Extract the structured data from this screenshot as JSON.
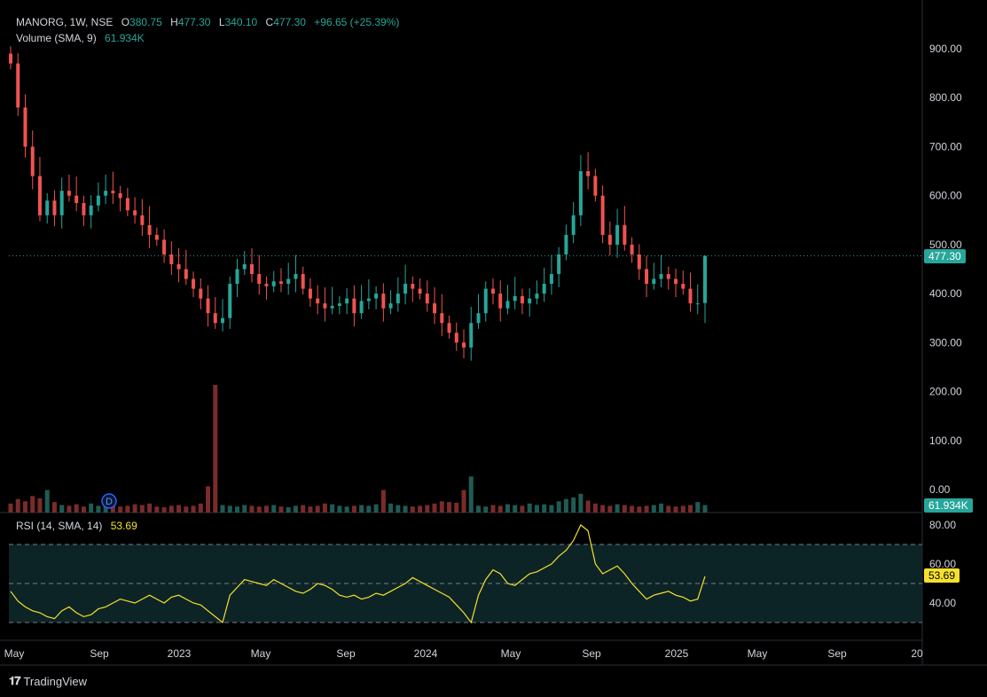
{
  "header": {
    "symbol": "MANORG, 1W, NSE",
    "o_label": "O",
    "o_value": "380.75",
    "h_label": "H",
    "h_value": "477.30",
    "l_label": "L",
    "l_value": "340.10",
    "c_label": "C",
    "c_value": "477.30",
    "change": "+96.65 (+25.39%)",
    "volume_label": "Volume (SMA, 9)",
    "volume_value": "61.934K",
    "rsi_label": "RSI (14, SMA, 14)",
    "rsi_value": "53.69"
  },
  "tags": {
    "price_last": "477.30",
    "volume_last": "61.934K",
    "rsi_last": "53.69"
  },
  "footer": {
    "brand": "TradingView"
  },
  "colors": {
    "up": "#26a69a",
    "down": "#ef5350",
    "rsi": "#f5e02c",
    "vol_up": "#1f5b55",
    "vol_down": "#7a2b2b",
    "rsi_band": "#0d2426"
  },
  "chart_data": [
    {
      "type": "candlestick",
      "price_axis": {
        "ticks": [
          "900.00",
          "800.00",
          "700.00",
          "600.00",
          "500.00",
          "400.00",
          "300.00",
          "200.00",
          "100.00",
          "0.00"
        ],
        "ylim": [
          0,
          900
        ]
      },
      "x_ticks": [
        "May",
        "Sep",
        "2023",
        "May",
        "Sep",
        "2024",
        "May",
        "Sep",
        "2025",
        "May",
        "Sep",
        "20"
      ],
      "last_price": 477.3,
      "series": [
        {
          "name": "close",
          "values": [
            870,
            780,
            700,
            640,
            560,
            590,
            560,
            610,
            600,
            585,
            560,
            580,
            600,
            610,
            605,
            595,
            570,
            560,
            540,
            520,
            510,
            480,
            460,
            450,
            430,
            410,
            390,
            360,
            340,
            350,
            420,
            450,
            460,
            440,
            420,
            415,
            425,
            420,
            430,
            440,
            410,
            390,
            380,
            370,
            375,
            380,
            390,
            360,
            385,
            390,
            400,
            370,
            380,
            400,
            420,
            410,
            400,
            380,
            360,
            340,
            320,
            300,
            290,
            340,
            360,
            410,
            400,
            370,
            385,
            395,
            380,
            390,
            400,
            420,
            440,
            480,
            520,
            560,
            650,
            640,
            600,
            520,
            500,
            540,
            500,
            480,
            450,
            420,
            430,
            440,
            430,
            420,
            410,
            380,
            380,
            477.3
          ]
        }
      ]
    },
    {
      "type": "bar",
      "name": "Volume",
      "values": [
        12,
        18,
        15,
        22,
        19,
        30,
        14,
        10,
        9,
        11,
        8,
        12,
        9,
        10,
        14,
        8,
        9,
        11,
        10,
        12,
        8,
        7,
        9,
        10,
        8,
        9,
        12,
        35,
        170,
        10,
        9,
        8,
        10,
        9,
        8,
        9,
        10,
        8,
        7,
        9,
        10,
        8,
        9,
        12,
        11,
        9,
        8,
        9,
        10,
        9,
        11,
        30,
        12,
        10,
        9,
        8,
        9,
        10,
        12,
        15,
        14,
        13,
        30,
        48,
        9,
        8,
        10,
        9,
        11,
        10,
        9,
        12,
        10,
        11,
        10,
        15,
        18,
        20,
        25,
        16,
        12,
        10,
        9,
        11,
        10,
        9,
        8,
        9,
        10,
        12,
        9,
        8,
        9,
        10,
        14,
        10
      ]
    },
    {
      "type": "line",
      "name": "RSI",
      "ylim": [
        25,
        85
      ],
      "ticks": [
        "80.00",
        "60.00",
        "40.00"
      ],
      "bands": [
        70,
        50,
        30
      ],
      "values": [
        46,
        41,
        38,
        36,
        35,
        33,
        32,
        36,
        38,
        35,
        33,
        34,
        37,
        38,
        40,
        42,
        41,
        40,
        42,
        44,
        42,
        40,
        43,
        44,
        42,
        40,
        39,
        36,
        33,
        30,
        44,
        48,
        52,
        51,
        50,
        49,
        52,
        50,
        48,
        46,
        45,
        47,
        50,
        49,
        47,
        44,
        43,
        44,
        42,
        43,
        45,
        44,
        46,
        48,
        50,
        53,
        51,
        49,
        47,
        45,
        43,
        39,
        35,
        30,
        44,
        52,
        57,
        55,
        50,
        49,
        52,
        55,
        56,
        58,
        60,
        64,
        67,
        72,
        80,
        77,
        60,
        55,
        57,
        59,
        55,
        50,
        46,
        42,
        44,
        45,
        46,
        44,
        43,
        41,
        42,
        53.69
      ]
    }
  ]
}
